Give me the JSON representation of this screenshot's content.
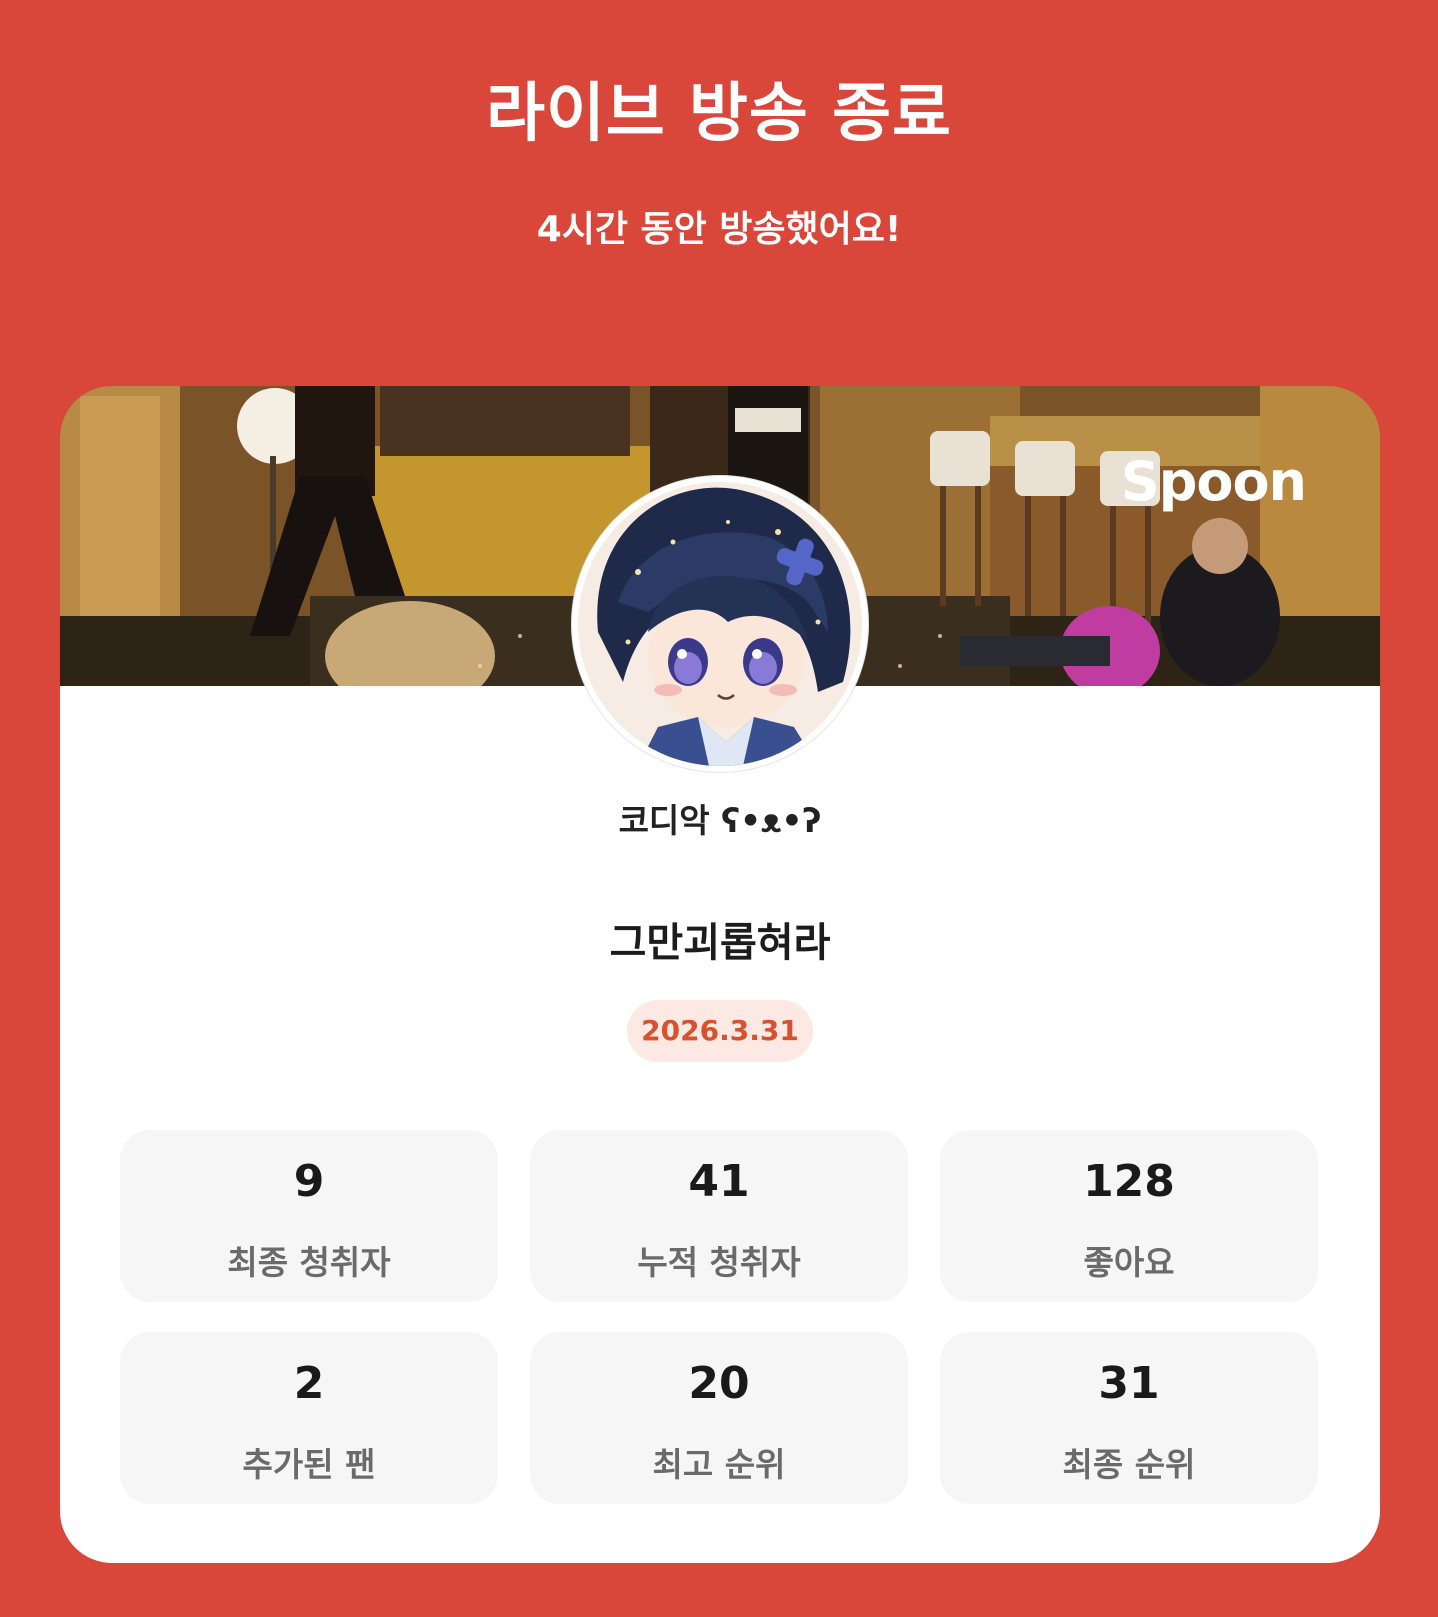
{
  "header": {
    "title": "라이브 방송 종료",
    "subtitle": "4시간 동안 방송했어요!"
  },
  "card": {
    "brand": "Spoon",
    "banner_image": "live-room-background-image",
    "avatar_image": "streamer-avatar-image",
    "streamer_name": "코디악 ʕ•ᴥ•ʔ",
    "broadcast_title": "그만괴롭혀라",
    "date": "2026.3.31"
  },
  "stats": [
    {
      "value": "9",
      "label": "최종 청취자"
    },
    {
      "value": "41",
      "label": "누적 청취자"
    },
    {
      "value": "128",
      "label": "좋아요"
    },
    {
      "value": "2",
      "label": "추가된 팬"
    },
    {
      "value": "20",
      "label": "최고 순위"
    },
    {
      "value": "31",
      "label": "최종 순위"
    }
  ],
  "colors": {
    "background": "#d9473b",
    "card": "#ffffff",
    "stat_card": "#f6f6f6",
    "date_badge_bg": "#fde9e3",
    "date_badge_text": "#d9512c"
  }
}
